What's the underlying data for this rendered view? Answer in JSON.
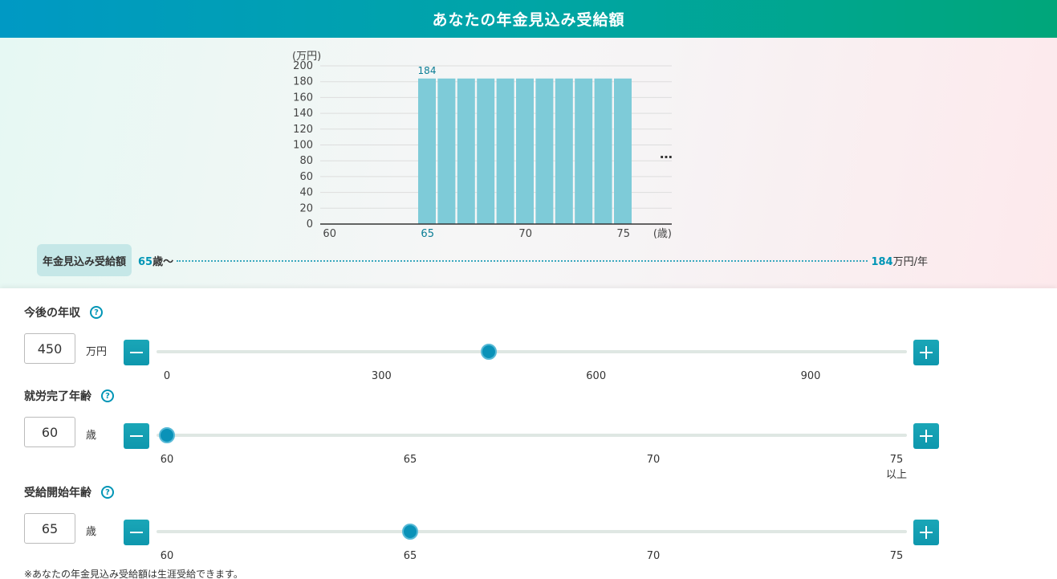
{
  "header": {
    "title": "あなたの年金見込み受給額"
  },
  "chart_data": {
    "type": "bar",
    "yunit": "(万円)",
    "xunit": "(歳)",
    "ylim": [
      0,
      200
    ],
    "yticks": [
      0,
      20,
      40,
      60,
      80,
      100,
      120,
      140,
      160,
      180,
      200
    ],
    "xticks": [
      60,
      65,
      70,
      75
    ],
    "highlight_tick": 65,
    "categories": [
      60,
      61,
      62,
      63,
      64,
      65,
      66,
      67,
      68,
      69,
      70,
      71,
      72,
      73,
      74,
      75
    ],
    "values": [
      0,
      0,
      0,
      0,
      0,
      184,
      184,
      184,
      184,
      184,
      184,
      184,
      184,
      184,
      184,
      184
    ],
    "data_label": "184",
    "continuation": "…",
    "grid": true,
    "bar_color": "#7ecbd8"
  },
  "summary": {
    "label": "年金見込み受給額",
    "age_number": "65",
    "age_suffix": "歳〜",
    "amount_number": "184",
    "amount_unit": "万円/年"
  },
  "income": {
    "title": "今後の年収",
    "help": "?",
    "value": "450",
    "unit": "万円",
    "min": 0,
    "max": 1020,
    "current": 450,
    "ticks": [
      "0",
      "300",
      "600",
      "900"
    ],
    "tick_values": [
      0,
      300,
      600,
      900
    ]
  },
  "retire_age": {
    "title": "就労完了年齢",
    "help": "?",
    "value": "60",
    "unit": "歳",
    "min": 60,
    "max": 75,
    "current": 60,
    "ticks": [
      "60",
      "65",
      "70",
      "75"
    ],
    "tick_values": [
      60,
      65,
      70,
      75
    ],
    "last_tick_sub": "以上"
  },
  "start_age": {
    "title": "受給開始年齢",
    "help": "?",
    "value": "65",
    "unit": "歳",
    "min": 60,
    "max": 75,
    "current": 65,
    "ticks": [
      "60",
      "65",
      "70",
      "75"
    ],
    "tick_values": [
      60,
      65,
      70,
      75
    ]
  },
  "footnote": "※あなたの年金見込み受給額は生涯受給できます。"
}
